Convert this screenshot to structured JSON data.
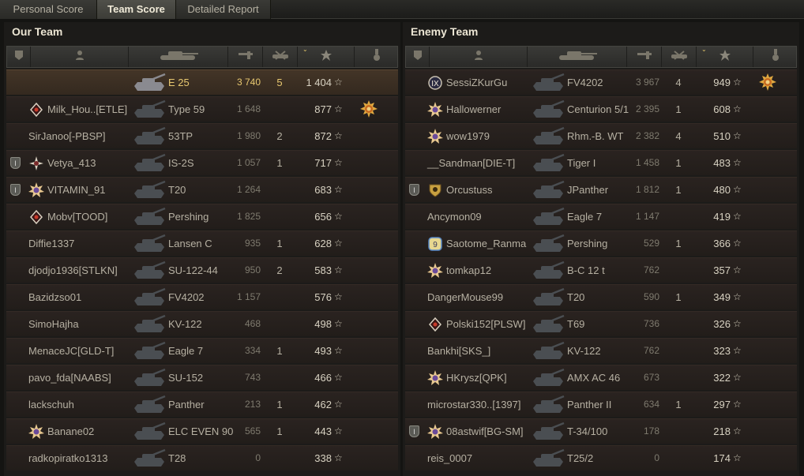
{
  "tabs": [
    {
      "label": "Personal Score"
    },
    {
      "label": "Team Score"
    },
    {
      "label": "Detailed Report"
    }
  ],
  "our_team": {
    "title": "Our Team",
    "players": [
      {
        "name": "",
        "tank": "E 25",
        "damage": "3 740",
        "kills": "5",
        "xp": "1 404",
        "is_me": true
      },
      {
        "name": "Milk_Hou..[ETLE]",
        "tank": "Type 59",
        "damage": "1 648",
        "kills": "",
        "xp": "877",
        "rank": "diamond",
        "medal": true
      },
      {
        "name": "SirJanoo[-PBSP]",
        "tank": "53TP",
        "damage": "1 980",
        "kills": "2",
        "xp": "872"
      },
      {
        "name": "Vetya_413",
        "tank": "IS-2S",
        "damage": "1 057",
        "kills": "1",
        "xp": "717",
        "rank": "star4",
        "platoon": true
      },
      {
        "name": "VITAMIN_91",
        "tank": "T20",
        "damage": "1 264",
        "kills": "",
        "xp": "683",
        "rank": "sun",
        "platoon": true
      },
      {
        "name": "Mobv[TOOD]",
        "tank": "Pershing",
        "damage": "1 825",
        "kills": "",
        "xp": "656",
        "rank": "diamond"
      },
      {
        "name": "Diffie1337",
        "tank": "Lansen C",
        "damage": "935",
        "kills": "1",
        "xp": "628"
      },
      {
        "name": "djodjo1936[STLKN]",
        "tank": "SU-122-44",
        "damage": "950",
        "kills": "2",
        "xp": "583"
      },
      {
        "name": "Bazidzso01",
        "tank": "FV4202",
        "damage": "1 157",
        "kills": "",
        "xp": "576"
      },
      {
        "name": "SimoHajha",
        "tank": "KV-122",
        "damage": "468",
        "kills": "",
        "xp": "498"
      },
      {
        "name": "MenaceJC[GLD-T]",
        "tank": "Eagle 7",
        "damage": "334",
        "kills": "1",
        "xp": "493"
      },
      {
        "name": "pavo_fda[NAABS]",
        "tank": "SU-152",
        "damage": "743",
        "kills": "",
        "xp": "466"
      },
      {
        "name": "lackschuh",
        "tank": "Panther",
        "damage": "213",
        "kills": "1",
        "xp": "462"
      },
      {
        "name": "Banane02",
        "tank": "ELC EVEN 90",
        "damage": "565",
        "kills": "1",
        "xp": "443",
        "rank": "sun"
      },
      {
        "name": "radkopiratko1313",
        "tank": "T28",
        "damage": "0",
        "kills": "",
        "xp": "338"
      }
    ]
  },
  "enemy_team": {
    "title": "Enemy Team",
    "players": [
      {
        "name": "SessiZKurGu",
        "tank": "FV4202",
        "damage": "3 967",
        "kills": "4",
        "xp": "949",
        "rank": "nine",
        "medal": true
      },
      {
        "name": "Hallowerner",
        "tank": "Centurion 5/1",
        "damage": "2 395",
        "kills": "1",
        "xp": "608",
        "rank": "sun"
      },
      {
        "name": "wow1979",
        "tank": "Rhm.-B. WT",
        "damage": "2 382",
        "kills": "4",
        "xp": "510",
        "rank": "sun"
      },
      {
        "name": "__Sandman[DIE-T]",
        "tank": "Tiger I",
        "damage": "1 458",
        "kills": "1",
        "xp": "483"
      },
      {
        "name": "Orcustuss",
        "tank": "JPanther",
        "damage": "1 812",
        "kills": "1",
        "xp": "480",
        "rank": "shieldgold",
        "platoon": true
      },
      {
        "name": "Ancymon09",
        "tank": "Eagle 7",
        "damage": "1 147",
        "kills": "",
        "xp": "419"
      },
      {
        "name": "Saotome_Ranma",
        "tank": "Pershing",
        "damage": "529",
        "kills": "1",
        "xp": "366",
        "rank": "badge9"
      },
      {
        "name": "tomkap12",
        "tank": "B-C 12 t",
        "damage": "762",
        "kills": "",
        "xp": "357",
        "rank": "sun"
      },
      {
        "name": "DangerMouse99",
        "tank": "T20",
        "damage": "590",
        "kills": "1",
        "xp": "349"
      },
      {
        "name": "Polski152[PLSW]",
        "tank": "T69",
        "damage": "736",
        "kills": "",
        "xp": "326",
        "rank": "diamond"
      },
      {
        "name": "Bankhi[SKS_]",
        "tank": "KV-122",
        "damage": "762",
        "kills": "",
        "xp": "323"
      },
      {
        "name": "HKrysz[QPK]",
        "tank": "AMX AC 46",
        "damage": "673",
        "kills": "",
        "xp": "322",
        "rank": "sun"
      },
      {
        "name": "microstar330..[1397]",
        "tank": "Panther II",
        "damage": "634",
        "kills": "1",
        "xp": "297"
      },
      {
        "name": "08astwif[BG-SM]",
        "tank": "T-34/100",
        "damage": "178",
        "kills": "",
        "xp": "218",
        "rank": "sun",
        "platoon": true
      },
      {
        "name": "reis_0007",
        "tank": "T25/2",
        "damage": "0",
        "kills": "",
        "xp": "174"
      }
    ]
  },
  "icons": {
    "header": [
      "squad-icon",
      "player-icon",
      "tank-icon",
      "damage-icon",
      "kills-icon",
      "xp-star-icon",
      "medal-icon"
    ],
    "star_glyph": "☆",
    "sort_glyph": "⌄"
  },
  "colors": {
    "highlight_row": "#433527",
    "highlight_text": "#e8c870",
    "sort_arrow": "#e6c86a"
  }
}
